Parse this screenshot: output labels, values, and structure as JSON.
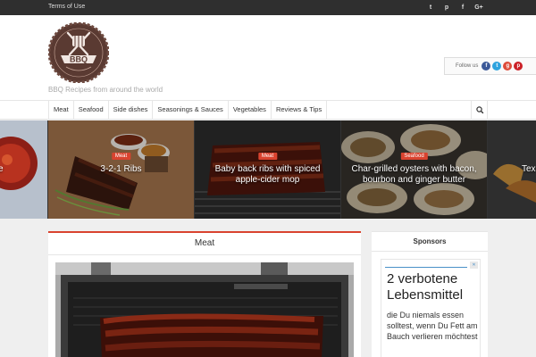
{
  "topbar": {
    "terms_label": "Terms of Use",
    "social": [
      {
        "icon": "twitter-icon",
        "glyph": "t"
      },
      {
        "icon": "pinterest-icon",
        "glyph": "p"
      },
      {
        "icon": "facebook-icon",
        "glyph": "f"
      },
      {
        "icon": "google-plus-icon",
        "glyph": "G+"
      }
    ]
  },
  "header": {
    "logo_text": "BBQ",
    "tagline": "BBQ Recipes from around the world",
    "follow_label": "Follow us",
    "follow_icons": [
      {
        "icon": "facebook-icon",
        "glyph": "f",
        "color": "#3b5998"
      },
      {
        "icon": "twitter-icon",
        "glyph": "t",
        "color": "#2ea3de"
      },
      {
        "icon": "google-plus-icon",
        "glyph": "g",
        "color": "#dd4b39"
      },
      {
        "icon": "pinterest-icon",
        "glyph": "p",
        "color": "#cb2027"
      }
    ]
  },
  "nav": {
    "items": [
      "Meat",
      "Seafood",
      "Side dishes",
      "Seasonings & Sauces",
      "Vegetables",
      "Reviews & Tips"
    ],
    "search_icon": "search-icon"
  },
  "slider": {
    "slides": [
      {
        "category": "",
        "title": "e"
      },
      {
        "category": "Meat",
        "title": "3-2-1 Ribs"
      },
      {
        "category": "Meat",
        "title": "Baby back ribs with spiced apple-cider mop"
      },
      {
        "category": "Seafood",
        "title": "Char-grilled oysters with bacon, bourbon and ginger butter"
      },
      {
        "category": "",
        "title": "Tex"
      }
    ]
  },
  "main": {
    "heading": "Meat"
  },
  "sidebar": {
    "heading": "Sponsors",
    "ad_big": "2 verbotene Lebensmittel",
    "ad_small": "die Du niemals essen solltest, wenn Du Fett am Bauch verlieren möchtest"
  },
  "colors": {
    "accent": "#d9432f",
    "topbar": "#2f2f2f"
  }
}
